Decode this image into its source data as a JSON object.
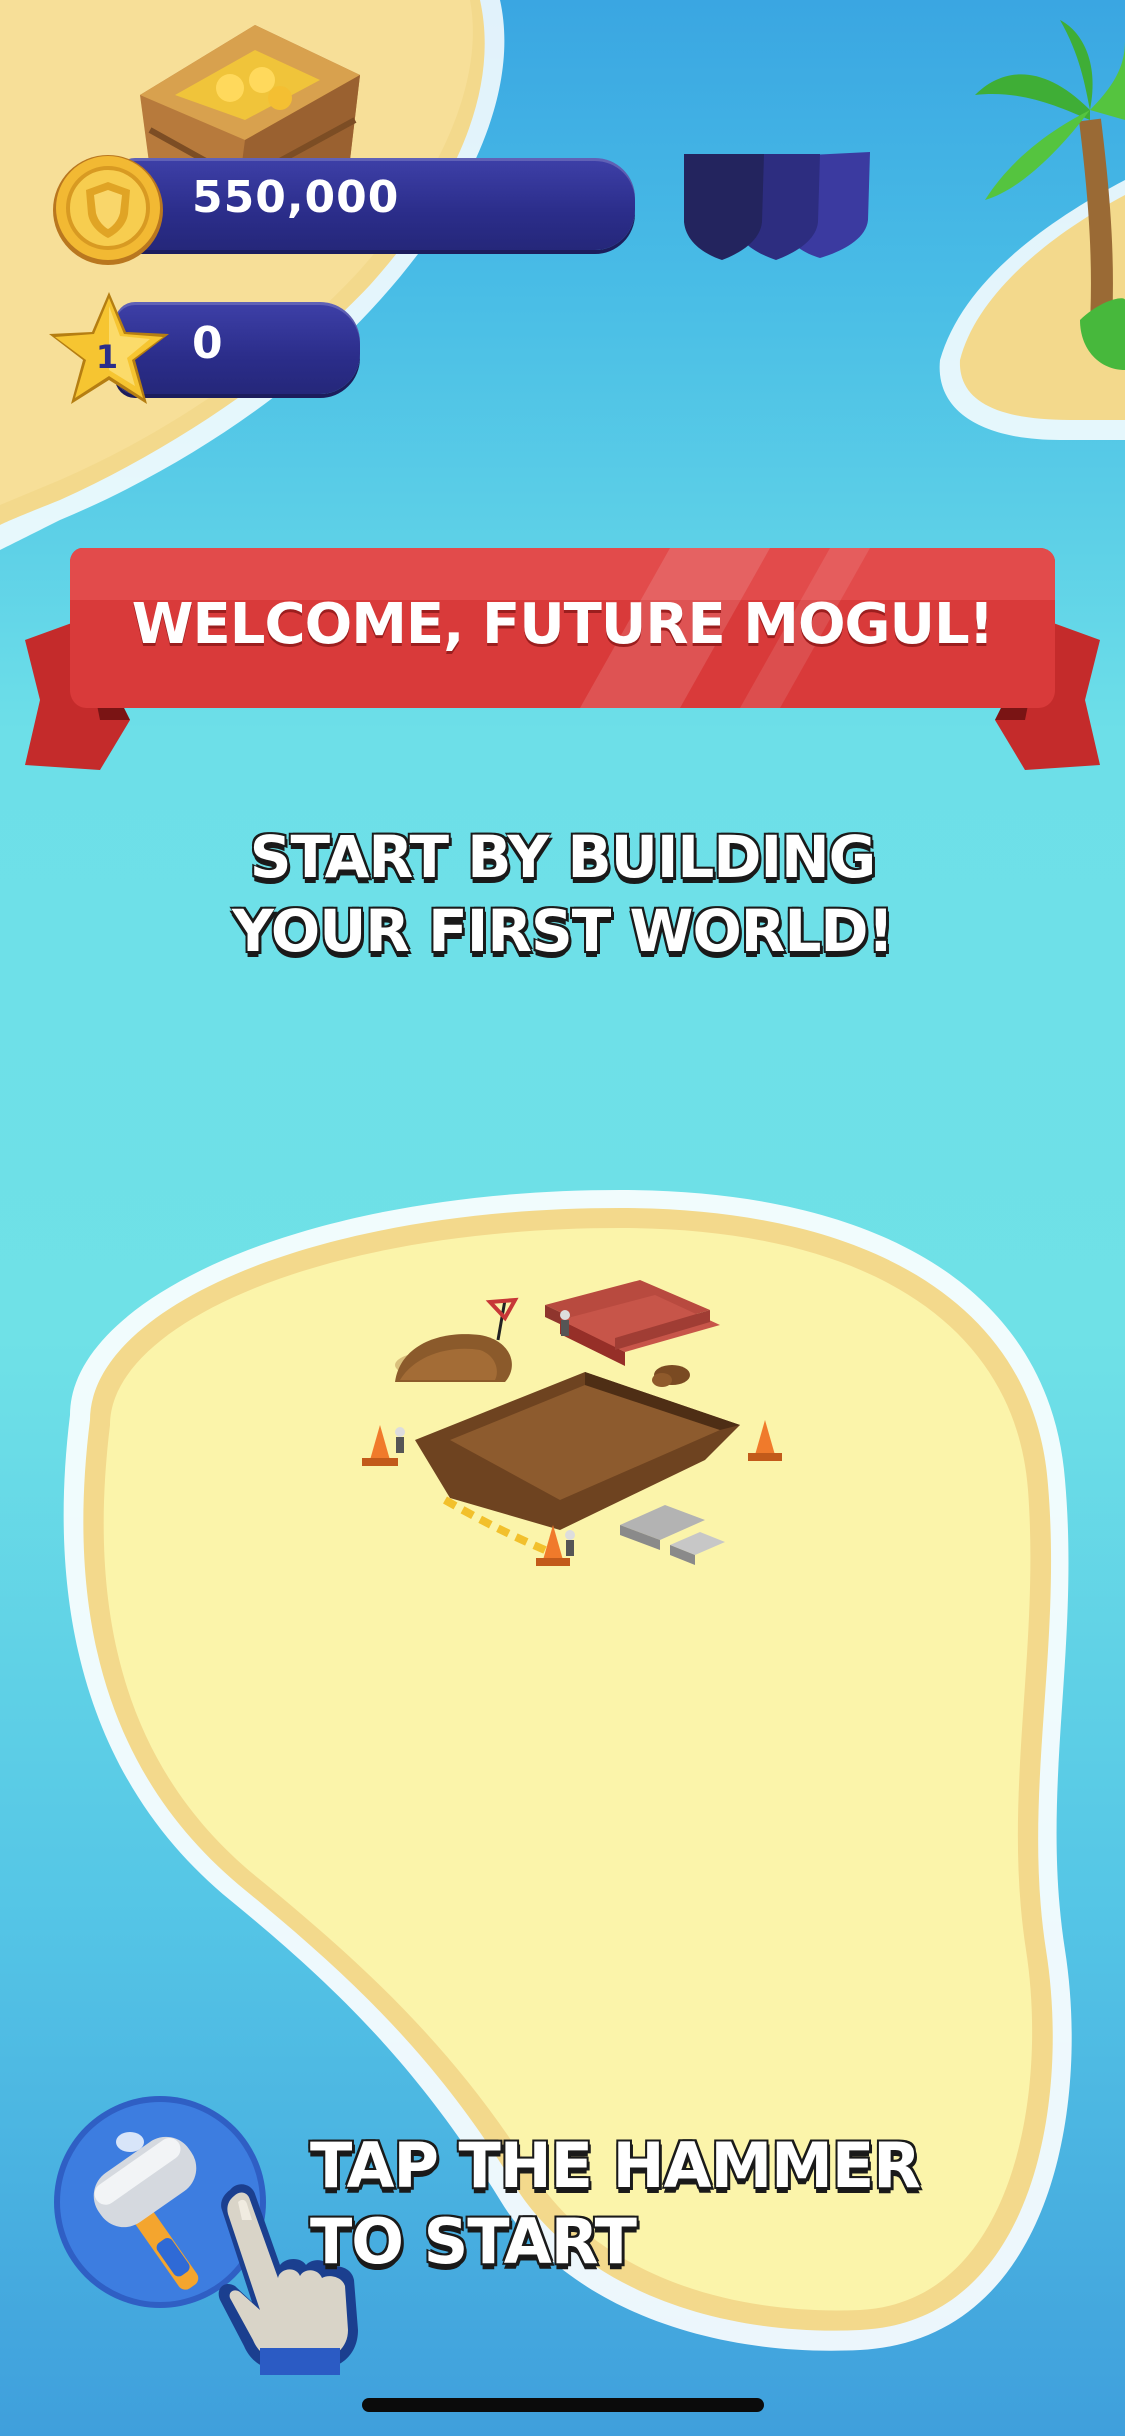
{
  "hud": {
    "coins_value": "550,000",
    "coin_icon": "coin-shield-icon",
    "stars_value": "0",
    "star_level": "1",
    "star_icon": "star-level-icon",
    "shields_icon": "shields-icon"
  },
  "banner": {
    "title": "WELCOME, FUTURE MOGUL!",
    "color": "#d93a3a"
  },
  "intro": {
    "line1": "START BY BUILDING",
    "line2": "YOUR FIRST WORLD!"
  },
  "hint": {
    "line1": "TAP THE HAMMER",
    "line2": "TO START",
    "button_icon": "hammer-icon",
    "pointer_icon": "pointing-hand-icon"
  },
  "colors": {
    "sea": "#6fe1e7",
    "sand": "#fbf2a6",
    "hud_bar": "#2b2d8a"
  }
}
